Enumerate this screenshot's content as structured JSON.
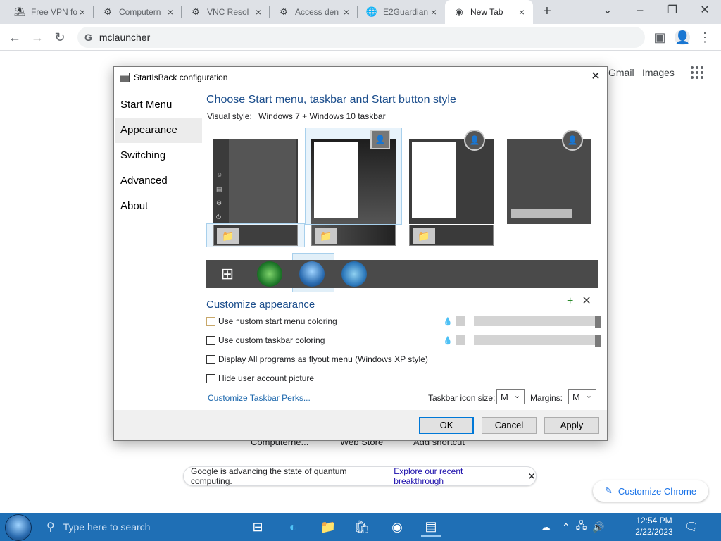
{
  "browser": {
    "tabs": [
      {
        "title": "Free VPN fo",
        "icon": "vpn-icon"
      },
      {
        "title": "Computern",
        "icon": "gear-icon"
      },
      {
        "title": "VNC Resol",
        "icon": "gear-icon"
      },
      {
        "title": "Access den",
        "icon": "gear-icon"
      },
      {
        "title": "E2Guardian",
        "icon": "globe-icon"
      },
      {
        "title": "New Tab",
        "icon": "chrome-icon"
      }
    ],
    "url": "mclauncher",
    "links": {
      "gmail": "Gmail",
      "images": "Images"
    },
    "shortcuts": [
      "Computerne...",
      "Web Store",
      "Add shortcut"
    ],
    "notice": {
      "text": "Google is advancing the state of quantum computing.",
      "link": "Explore our recent breakthrough"
    },
    "customize": "Customize Chrome"
  },
  "dialog": {
    "title": "StartIsBack configuration",
    "nav": [
      "Start Menu",
      "Appearance",
      "Switching",
      "Advanced",
      "About"
    ],
    "selected_nav": "Appearance",
    "heading": "Choose Start menu, taskbar and Start button style",
    "visual_style_label": "Visual style:",
    "visual_style_value": "Windows 7 + Windows 10 taskbar",
    "customize_heading": "Customize appearance",
    "options": [
      {
        "label": "Use custom start menu coloring",
        "checked": false
      },
      {
        "label": "Use custom taskbar coloring",
        "checked": false
      },
      {
        "label": "Display All programs as flyout menu (Windows XP style)",
        "checked": false
      },
      {
        "label": "Hide user account picture",
        "checked": false
      }
    ],
    "perks_link": "Customize Taskbar Perks...",
    "icon_size_label": "Taskbar icon size:",
    "icon_size_value": "M",
    "margins_label": "Margins:",
    "margins_value": "M",
    "buttons": {
      "ok": "OK",
      "cancel": "Cancel",
      "apply": "Apply"
    }
  },
  "taskbar": {
    "search_placeholder": "Type here to search",
    "time": "12:54 PM",
    "date": "2/22/2023"
  }
}
